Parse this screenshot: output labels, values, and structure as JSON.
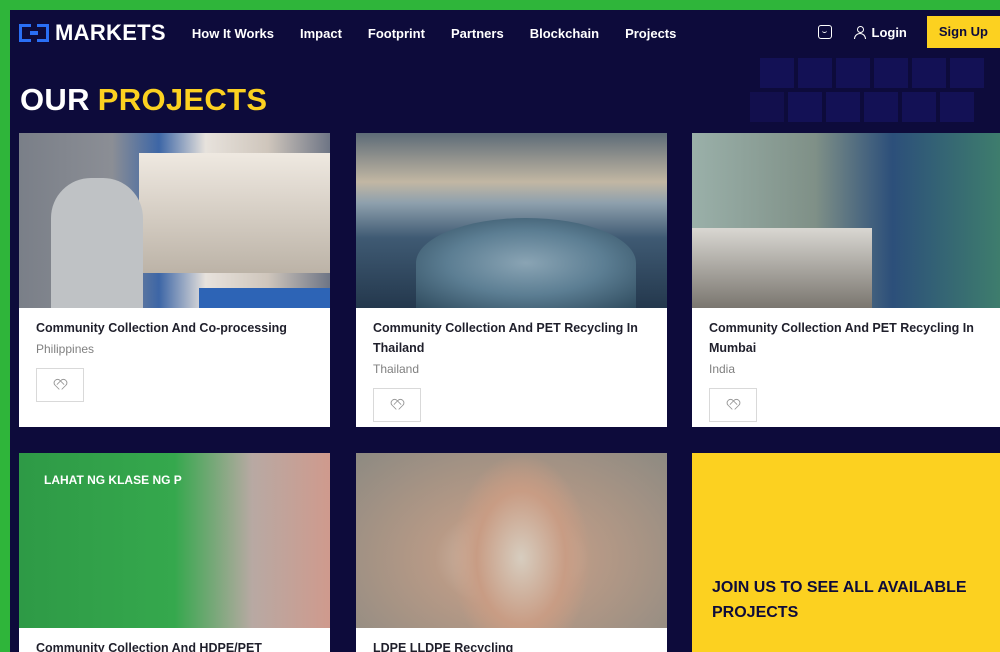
{
  "header": {
    "logo_text": "MARKETS",
    "nav": [
      "How It Works",
      "Impact",
      "Footprint",
      "Partners",
      "Blockchain",
      "Projects"
    ],
    "login_label": "Login",
    "signup_label": "Sign Up"
  },
  "page": {
    "title_part1": "OUR",
    "title_part2": "PROJECTS"
  },
  "projects": [
    {
      "name": "Community Collection And Co-processing",
      "location": "Philippines",
      "image_text": ""
    },
    {
      "name": "Community Collection And PET Recycling In Thailand",
      "location": "Thailand",
      "image_text": ""
    },
    {
      "name": "Community Collection And PET Recycling In Mumbai",
      "location": "India",
      "image_text": ""
    },
    {
      "name": "Community Collection And HDPE/PET",
      "location": "",
      "image_text": "LAHAT NG KLASE NG P"
    },
    {
      "name": "LDPE LLDPE Recycling",
      "location": "",
      "image_text": ""
    }
  ],
  "cta": {
    "text": "JOIN US TO SEE ALL AVAILABLE PROJECTS"
  },
  "colors": {
    "background": "#0d0b3b",
    "accent": "#fcd120",
    "logo_blue": "#2a6ff5",
    "frame": "#2fb53a"
  },
  "icons": [
    "cart-icon",
    "user-icon",
    "heart-icon"
  ]
}
